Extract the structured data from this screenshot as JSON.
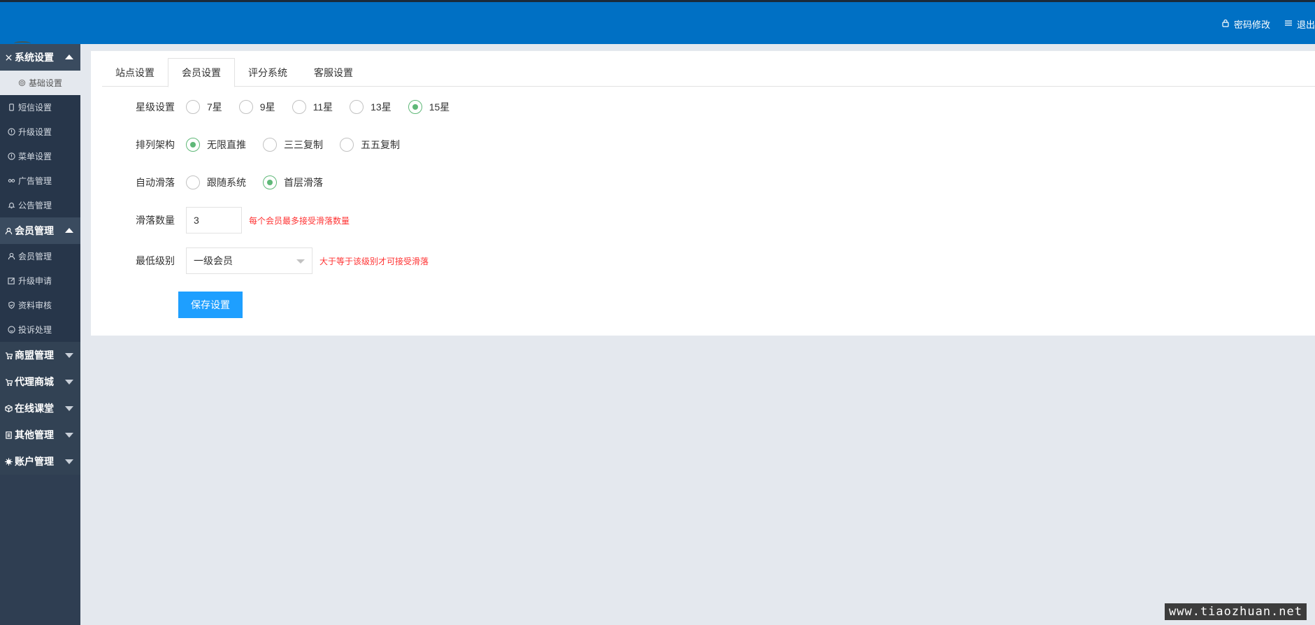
{
  "header": {
    "links": [
      {
        "label": "密码修改",
        "icon": "lock-icon"
      },
      {
        "label": "退出",
        "icon": "menu-lines-icon"
      }
    ]
  },
  "sidebar": {
    "groups": [
      {
        "label": "系统设置",
        "icon": "tools-icon",
        "open": true,
        "items": [
          {
            "label": "基础设置",
            "icon": "gear-icon",
            "active": true
          },
          {
            "label": "短信设置",
            "icon": "phone-icon"
          },
          {
            "label": "升级设置",
            "icon": "info-circle-icon"
          },
          {
            "label": "菜单设置",
            "icon": "info-circle-icon"
          },
          {
            "label": "广告管理",
            "icon": "link-icon"
          },
          {
            "label": "公告管理",
            "icon": "bell-icon"
          }
        ]
      },
      {
        "label": "会员管理",
        "icon": "user-icon",
        "open": true,
        "items": [
          {
            "label": "会员管理",
            "icon": "person-icon"
          },
          {
            "label": "升级申请",
            "icon": "edit-icon"
          },
          {
            "label": "资料审核",
            "icon": "shield-icon"
          },
          {
            "label": "投诉处理",
            "icon": "smile-icon"
          }
        ]
      },
      {
        "label": "商盟管理",
        "icon": "cart-icon",
        "open": false
      },
      {
        "label": "代理商城",
        "icon": "cart-icon",
        "open": false
      },
      {
        "label": "在线课堂",
        "icon": "cube-icon",
        "open": false
      },
      {
        "label": "其他管理",
        "icon": "document-icon",
        "open": false
      },
      {
        "label": "账户管理",
        "icon": "cog-icon",
        "open": false
      }
    ]
  },
  "tabs": [
    {
      "label": "站点设置",
      "active": false
    },
    {
      "label": "会员设置",
      "active": true
    },
    {
      "label": "评分系统",
      "active": false
    },
    {
      "label": "客服设置",
      "active": false
    }
  ],
  "form": {
    "star": {
      "label": "星级设置",
      "options": [
        "7星",
        "9星",
        "11星",
        "13星",
        "15星"
      ],
      "selected": "15星"
    },
    "arrange": {
      "label": "排列架构",
      "options": [
        "无限直推",
        "三三复制",
        "五五复制"
      ],
      "selected": "无限直推"
    },
    "slide": {
      "label": "自动滑落",
      "options": [
        "跟随系统",
        "首层滑落"
      ],
      "selected": "首层滑落"
    },
    "slide_count": {
      "label": "滑落数量",
      "value": "3",
      "hint": "每个会员最多接受滑落数量"
    },
    "min_level": {
      "label": "最低级别",
      "value": "一级会员",
      "hint": "大于等于该级别才可接受滑落"
    },
    "save_label": "保存设置"
  },
  "watermark": "www.tiaozhuan.net",
  "colors": {
    "header": "#0070c4",
    "sidebar": "#2f3e52",
    "primary_button": "#1e9fff",
    "radio_checked": "#5fb878",
    "hint": "#ff3333"
  }
}
